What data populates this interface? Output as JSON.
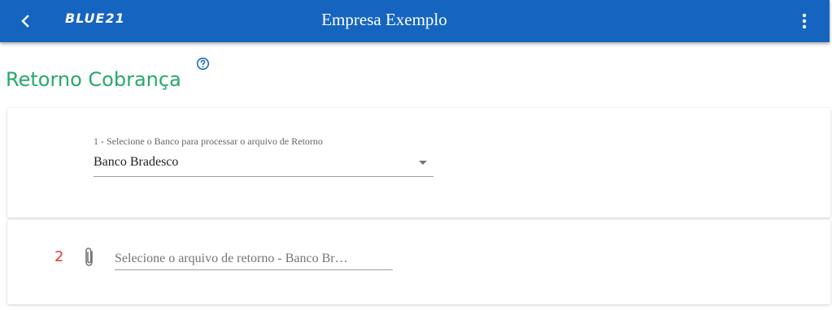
{
  "header": {
    "back_icon": "chevron-left-icon",
    "logo_text": "BLUE21",
    "title": "Empresa Exemplo",
    "menu_icon": "more-vertical-icon",
    "background_color": "#1565c0"
  },
  "page": {
    "title": "Retorno Cobrança",
    "title_color": "#26a96c",
    "help_icon": "help-circle-icon"
  },
  "step1": {
    "label": "1 - Selecione o Banco para processar o arquivo de Retorno",
    "selected_value": "Banco Bradesco",
    "dropdown_icon": "arrow-drop-down-icon"
  },
  "step2": {
    "number": "2",
    "number_color": "#e53935",
    "attach_icon": "paperclip-icon",
    "file_placeholder": "Selecione o arquivo de retorno - Banco Br…"
  }
}
